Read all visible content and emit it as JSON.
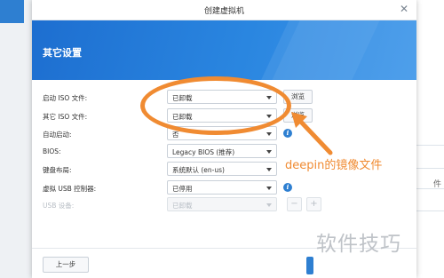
{
  "dialog": {
    "title": "创建虚拟机",
    "close_icon": "close-icon",
    "banner_title": "其它设置"
  },
  "settings": {
    "boot_iso": {
      "label": "启动 ISO 文件:",
      "value": "已卸载",
      "browse": "浏览"
    },
    "other_iso": {
      "label": "其它 ISO 文件:",
      "value": "已卸载",
      "browse": "浏览"
    },
    "autostart": {
      "label": "自动启动:",
      "value": "否"
    },
    "bios": {
      "label": "BIOS:",
      "value": "Legacy BIOS (推荐)"
    },
    "keyboard": {
      "label": "键盘布局:",
      "value": "系统默认 (en-us)"
    },
    "usb_controller": {
      "label": "虚拟 USB 控制器:",
      "value": "已停用"
    },
    "usb_device": {
      "label": "USB 设备:",
      "value": "已卸载",
      "minus": "−",
      "plus": "+"
    }
  },
  "footer": {
    "prev_label": "上一步"
  },
  "annotation": {
    "text": "deepin的镜像文件",
    "color": "#f08b32"
  },
  "watermark": {
    "text": "软件技巧"
  },
  "background": {
    "right_char": "件"
  }
}
